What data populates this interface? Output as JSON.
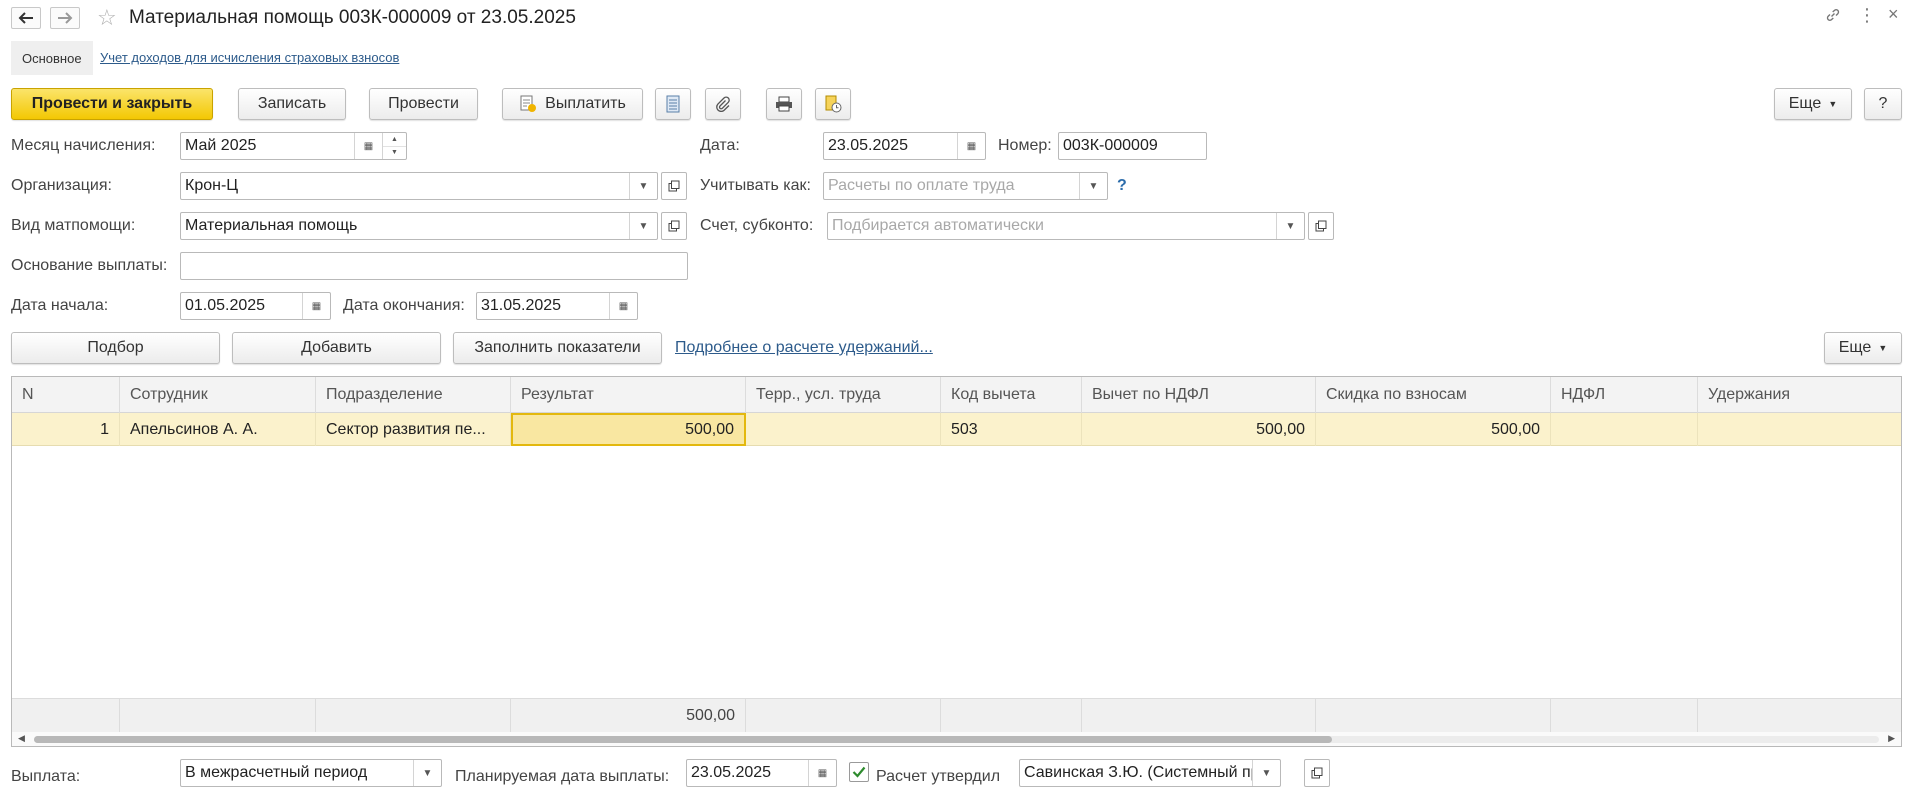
{
  "window": {
    "title": "Материальная помощь 003К-000009 от 23.05.2025"
  },
  "sections": {
    "main": "Основное",
    "link": "Учет доходов для исчисления страховых взносов"
  },
  "toolbar": {
    "post_close": "Провести и закрыть",
    "save": "Записать",
    "post": "Провести",
    "pay": "Выплатить",
    "more": "Еще",
    "help": "?"
  },
  "form": {
    "month_label": "Месяц начисления:",
    "month_value": "Май 2025",
    "date_label": "Дата:",
    "date_value": "23.05.2025",
    "number_label": "Номер:",
    "number_value": "003К-000009",
    "org_label": "Организация:",
    "org_value": "Крон-Ц",
    "account_as_label": "Учитывать как:",
    "account_as_placeholder": "Расчеты по оплате труда",
    "help_mark": "?",
    "aid_type_label": "Вид матпомощи:",
    "aid_type_value": "Материальная помощь",
    "subconto_label": "Счет, субконто:",
    "subconto_placeholder": "Подбирается автоматически",
    "reason_label": "Основание выплаты:",
    "reason_value": "",
    "start_label": "Дата начала:",
    "start_value": "01.05.2025",
    "end_label": "Дата окончания:",
    "end_value": "31.05.2025"
  },
  "table_toolbar": {
    "pick": "Подбор",
    "add": "Добавить",
    "fill": "Заполнить показатели",
    "details_link": "Подробнее о расчете удержаний...",
    "more": "Еще"
  },
  "table": {
    "columns": [
      "N",
      "Сотрудник",
      "Подразделение",
      "Результат",
      "Терр., усл. труда",
      "Код вычета",
      "Вычет по НДФЛ",
      "Скидка по взносам",
      "НДФЛ",
      "Удержания"
    ],
    "rows": [
      {
        "n": "1",
        "employee": "Апельсинов А. А.",
        "department": "Сектор развития пе...",
        "result": "500,00",
        "terr": "",
        "code": "503",
        "deduction": "500,00",
        "discount": "500,00",
        "ndfl": "",
        "withholdings": ""
      }
    ],
    "totals": {
      "result": "500,00"
    }
  },
  "bottom": {
    "payment_label": "Выплата:",
    "payment_value": "В межрасчетный период",
    "planned_label": "Планируемая дата выплаты:",
    "planned_value": "23.05.2025",
    "approved_label": "Расчет утвердил",
    "approved_checked": true,
    "approver_value": "Савинская З.Ю. (Системный про"
  }
}
